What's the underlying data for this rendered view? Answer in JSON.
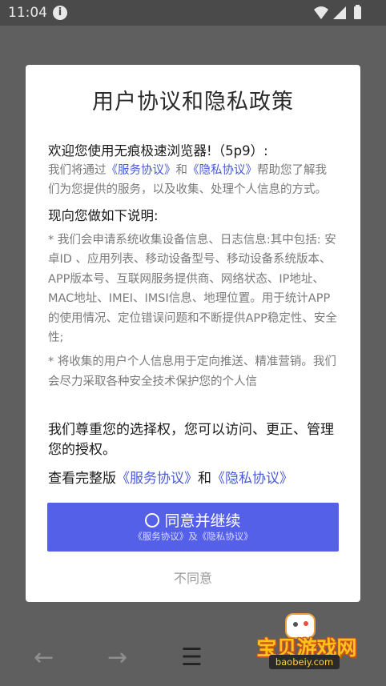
{
  "status_bar": {
    "time": "11:04",
    "info_icon": "i"
  },
  "dialog": {
    "title": "用户协议和隐私政策",
    "welcome": "欢迎您使用无痕极速浏览器!（5p9）:",
    "intro_pre": "我们将通过",
    "service_link": "《服务协议》",
    "intro_and": "和",
    "privacy_link": "《隐私协议》",
    "intro_post": "帮助您了解我们为您提供的服务，以及收集、处理个人信息的方式。",
    "subheading": "现向您做如下说明:",
    "bullet1": "* 我们会申请系统收集设备信息、日志信息:其中包括: 安卓ID 、应用列表、移动设备型号、移动设备系统版本、APP版本号、互联网服务提供商、网络状态、IP地址、MAC地址、IMEI、IMSI信息、地理位置。用于统计APP的使用情况、定位错误问题和不断提供APP稳定性、安全性;",
    "bullet2": "* 将收集的用户个人信息用于定向推送、精准营销。我们会尽力采取各种安全技术保护您的个人信",
    "choice_text": "我们尊重您的选择权，您可以访问、更正、管理您的授权。",
    "full_prefix": "查看完整版",
    "full_service_link": "《服务协议》",
    "full_and": "和",
    "full_privacy_link": "《隐私协议》",
    "agree_label": "同意并继续",
    "agree_sub": "《服务协议》及《隐私协议》",
    "disagree_label": "不同意"
  },
  "nav": {
    "back_icon": "←",
    "forward_icon": "→",
    "menu_icon": "☰"
  },
  "watermark": {
    "title": "宝贝游戏网",
    "url": "baobeiy.com"
  },
  "colors": {
    "accent": "#5560e8",
    "link": "#4a5bd8",
    "overlay": "#5f5f5f"
  }
}
